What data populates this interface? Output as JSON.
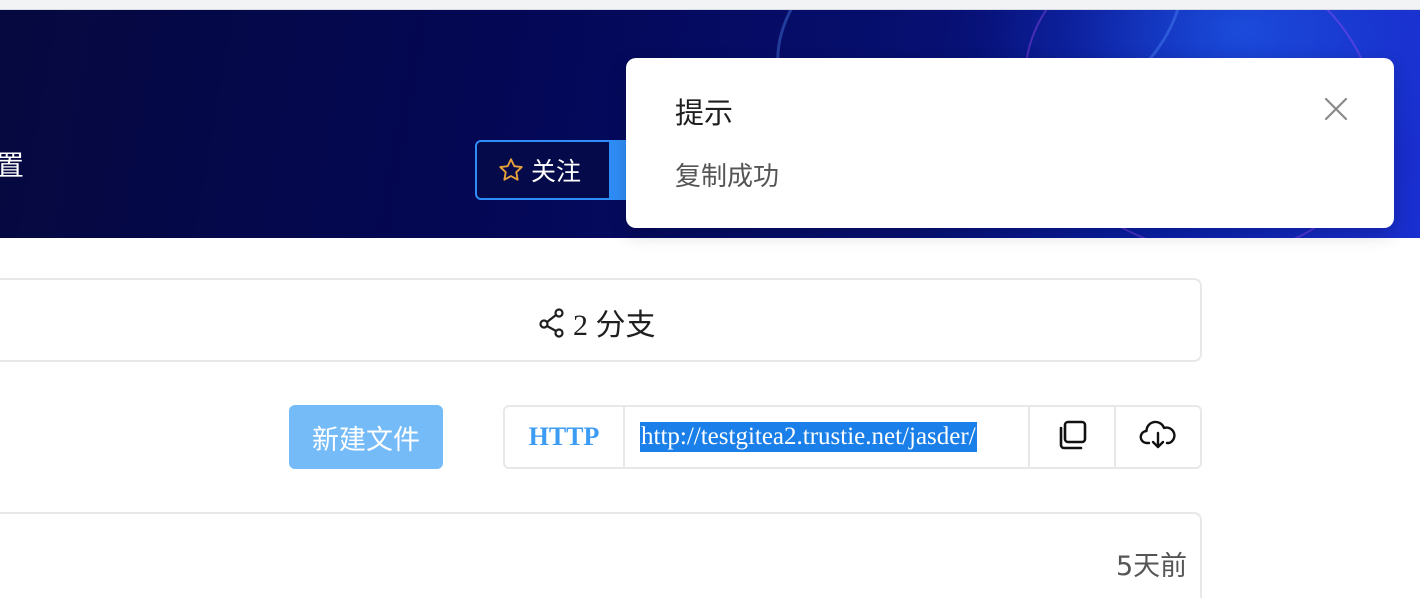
{
  "header": {
    "settings_label": "置",
    "watch_label": "关注"
  },
  "toast": {
    "title": "提示",
    "message": "复制成功"
  },
  "branches": {
    "count_label": "2 分支"
  },
  "actions": {
    "new_file_label": "新建文件"
  },
  "clone": {
    "protocol": "HTTP",
    "url": "http://testgitea2.trustie.net/jasder/"
  },
  "commit": {
    "time": "5天前"
  },
  "colors": {
    "accent": "#2f8df7",
    "banner_dark": "#040754",
    "new_file_button": "#74bbf8",
    "url_selection": "#1a7fe8",
    "star": "#e8a23a"
  }
}
